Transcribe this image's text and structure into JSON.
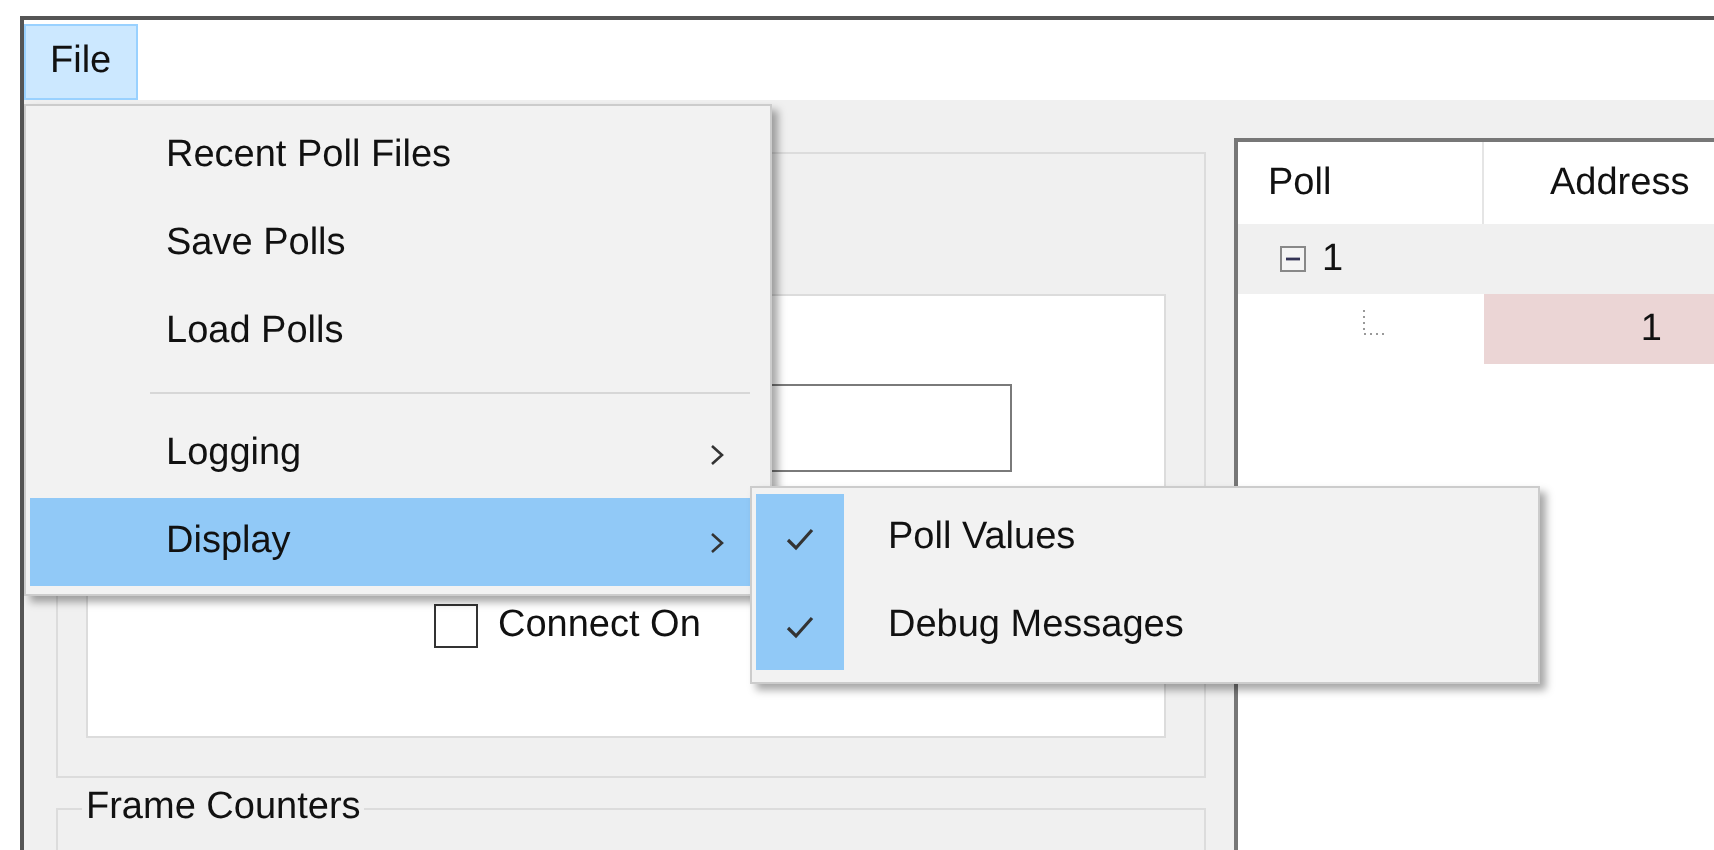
{
  "menu_bar": [
    {
      "label": "File",
      "selected": true
    }
  ],
  "file_menu": [
    {
      "kind": "item",
      "label": "Recent Poll Files",
      "selected": false,
      "has_submenu": false
    },
    {
      "kind": "item",
      "label": "Save Polls",
      "selected": false,
      "has_submenu": false
    },
    {
      "kind": "item",
      "label": "Load Polls",
      "selected": false,
      "has_submenu": false
    },
    {
      "kind": "separator"
    },
    {
      "kind": "item",
      "label": "Logging",
      "selected": false,
      "has_submenu": true
    },
    {
      "kind": "item",
      "label": "Display",
      "selected": true,
      "has_submenu": true
    }
  ],
  "display_submenu": [
    {
      "label": "Poll Values",
      "checked": true
    },
    {
      "label": "Debug Messages",
      "checked": true
    }
  ],
  "connection_panel": {
    "connect_on": {
      "label": "Connect On",
      "checked": false
    }
  },
  "frame_counters": {
    "title": "Frame Counters"
  },
  "poll_table": {
    "columns": [
      "Poll",
      "Address"
    ],
    "rows": [
      {
        "poll": "1",
        "expanded": true,
        "children": [
          {
            "address": "1"
          }
        ]
      }
    ]
  }
}
